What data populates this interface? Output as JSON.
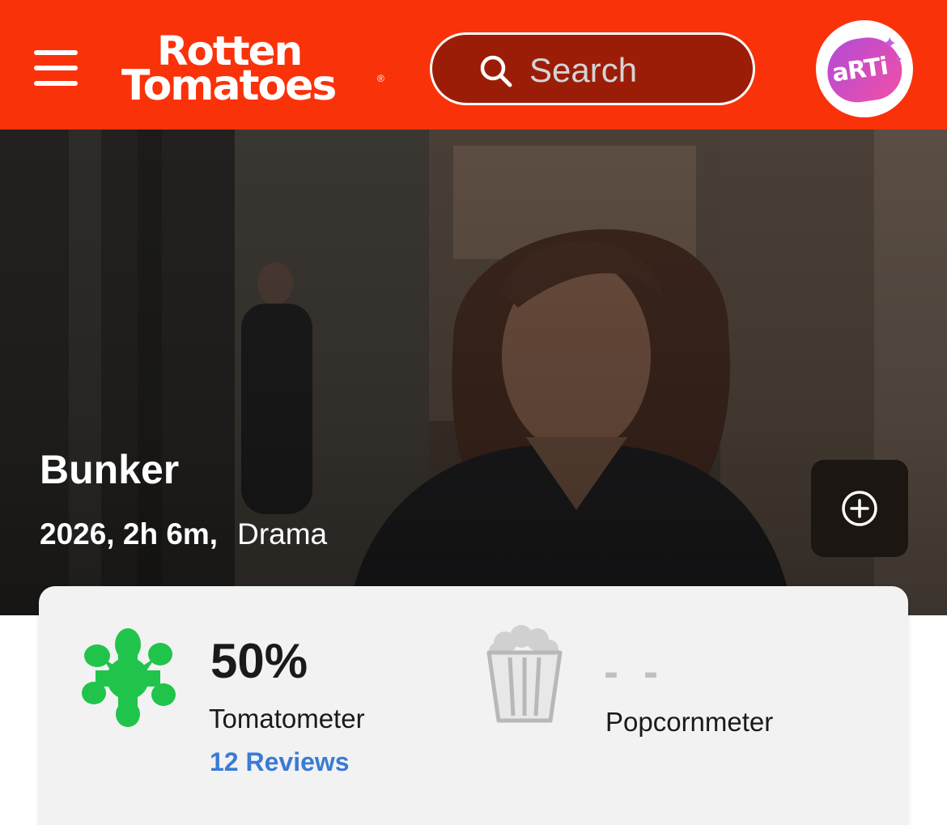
{
  "header": {
    "logo": {
      "line1": "Rotten",
      "line2": "Tomatoes",
      "registered": "®"
    },
    "search": {
      "placeholder": "Search"
    },
    "avatar": {
      "text": "aRTi"
    },
    "colors": {
      "brand": "#fa320a",
      "search_bg": "#9c1d07"
    }
  },
  "icons": {
    "menu": "hamburger-menu-icon",
    "search": "search-icon",
    "watchlist": "plus-circle-icon",
    "tomatometer": "green-splat-icon",
    "popcornmeter": "empty-popcorn-bucket-icon"
  },
  "movie": {
    "title": "Bunker",
    "year_runtime": "2026, 2h 6m,",
    "genre": "Drama"
  },
  "scores": {
    "tomatometer": {
      "value": "50%",
      "label": "Tomatometer",
      "reviews_link": "12 Reviews",
      "color": "#21c44b"
    },
    "popcornmeter": {
      "value": "- -",
      "label": "Popcornmeter"
    }
  }
}
